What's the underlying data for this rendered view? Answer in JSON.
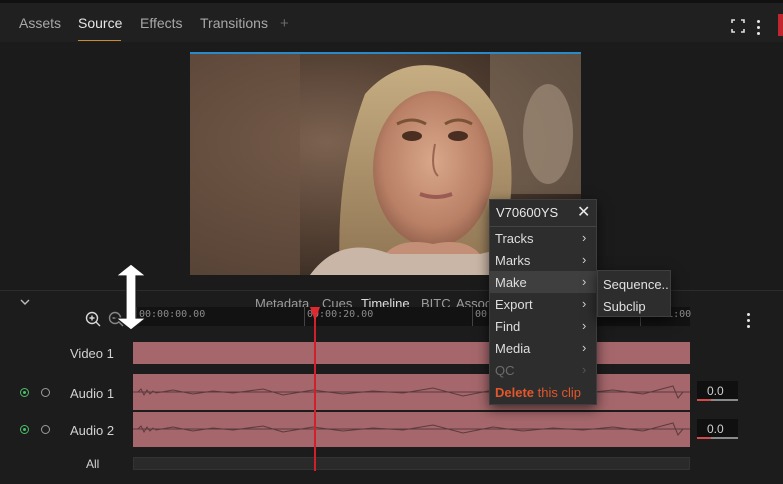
{
  "tabs": [
    {
      "label": "Assets"
    },
    {
      "label": "Source"
    },
    {
      "label": "Effects"
    },
    {
      "label": "Transitions"
    }
  ],
  "add_tab_label": "+",
  "timeline_tabs": [
    {
      "label": "Metadata"
    },
    {
      "label": "Cues"
    },
    {
      "label": "Timeline"
    },
    {
      "label": "BITC"
    },
    {
      "label": "Assoc"
    }
  ],
  "ruler": {
    "labels": [
      "00:00:00.00",
      "00:00:20.00",
      "00:",
      "00:01:00"
    ]
  },
  "tracks": {
    "video1": "Video 1",
    "audio1": "Audio 1",
    "audio2": "Audio 2",
    "all": "All"
  },
  "volumes": {
    "audio1": "0.0",
    "audio2": "0.0"
  },
  "context_menu": {
    "title": "V70600YS",
    "items": {
      "tracks": "Tracks",
      "marks": "Marks",
      "make": "Make",
      "export": "Export",
      "find": "Find",
      "media": "Media",
      "qc": "QC"
    },
    "delete_strong": "Delete",
    "delete_rest": " this clip"
  },
  "make_submenu": {
    "sequence": "Sequence..",
    "subclip": "Subclip"
  },
  "colors": {
    "accent": "#c98a34",
    "clip": "#a5676b",
    "playhead": "#d0202a",
    "delete": "#e2572c",
    "track_on": "#4cbf6a"
  }
}
